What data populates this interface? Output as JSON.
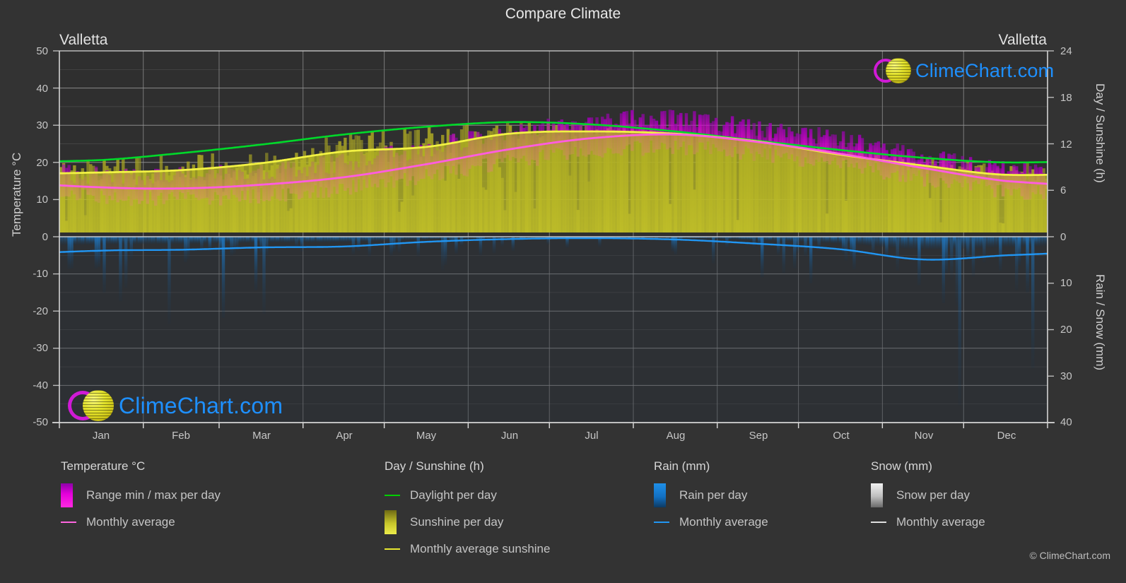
{
  "title": "Compare Climate",
  "city_left": "Valletta",
  "city_right": "Valletta",
  "axes": {
    "left_title": "Temperature °C",
    "right_title_top": "Day / Sunshine (h)",
    "right_title_bottom": "Rain / Snow (mm)",
    "left_ticks": [
      "50",
      "40",
      "30",
      "20",
      "10",
      "0",
      "-10",
      "-20",
      "-30",
      "-40",
      "-50"
    ],
    "right_ticks_top": [
      "24",
      "18",
      "12",
      "6",
      "0"
    ],
    "right_ticks_bottom": [
      "10",
      "20",
      "30",
      "40"
    ],
    "x_ticks": [
      "Jan",
      "Feb",
      "Mar",
      "Apr",
      "May",
      "Jun",
      "Jul",
      "Aug",
      "Sep",
      "Oct",
      "Nov",
      "Dec"
    ]
  },
  "legend": {
    "groups": [
      {
        "title": "Temperature °C",
        "items": [
          {
            "label": "Range min / max per day",
            "swatch": "gradient-magenta",
            "color": "#f000e0"
          },
          {
            "label": "Monthly average",
            "swatch": "line",
            "color": "#ff66e0"
          }
        ]
      },
      {
        "title": "Day / Sunshine (h)",
        "items": [
          {
            "label": "Daylight per day",
            "swatch": "line",
            "color": "#00d000"
          },
          {
            "label": "Sunshine per day",
            "swatch": "gradient-yellow",
            "color": "#e8e830"
          },
          {
            "label": "Monthly average sunshine",
            "swatch": "line",
            "color": "#e8e830"
          }
        ]
      },
      {
        "title": "Rain (mm)",
        "items": [
          {
            "label": "Rain per day",
            "swatch": "gradient-blue",
            "color": "#1a8fe0"
          },
          {
            "label": "Monthly average",
            "swatch": "line",
            "color": "#2196f3"
          }
        ]
      },
      {
        "title": "Snow (mm)",
        "items": [
          {
            "label": "Snow per day",
            "swatch": "gradient-white",
            "color": "#e0e0e0"
          },
          {
            "label": "Monthly average",
            "swatch": "line",
            "color": "#e0e0e0"
          }
        ]
      }
    ],
    "copyright": "© ClimeChart.com"
  },
  "logo": {
    "text": "ClimeChart.com"
  },
  "chart_data": {
    "type": "area",
    "title": "Compare Climate",
    "subtitle": "Valletta",
    "xlabel": "",
    "ylabel": "Temperature °C",
    "ylim": [
      -50,
      50
    ],
    "y2lim_top": [
      0,
      24
    ],
    "y2lim_bottom": [
      0,
      40
    ],
    "grid": true,
    "legend_position": "bottom",
    "categories": [
      "Jan",
      "Feb",
      "Mar",
      "Apr",
      "May",
      "Jun",
      "Jul",
      "Aug",
      "Sep",
      "Oct",
      "Nov",
      "Dec"
    ],
    "series": [
      {
        "name": "Monthly average temperature",
        "unit": "°C",
        "color": "#ff66e0",
        "axis": "left",
        "values": [
          13.3,
          13.0,
          14.0,
          16.0,
          19.5,
          23.5,
          26.5,
          27.5,
          25.5,
          22.3,
          18.5,
          15.0
        ]
      },
      {
        "name": "Daily max temperature",
        "unit": "°C",
        "color": "#d000d0",
        "axis": "left",
        "values": [
          16.2,
          16.0,
          17.3,
          19.6,
          23.5,
          27.8,
          30.8,
          31.3,
          29.0,
          25.7,
          21.6,
          17.9
        ]
      },
      {
        "name": "Daily min temperature",
        "unit": "°C",
        "color": "#d000d0",
        "axis": "left",
        "values": [
          10.5,
          10.2,
          11.1,
          13.0,
          16.2,
          20.1,
          22.9,
          23.9,
          22.2,
          19.3,
          15.6,
          12.3
        ]
      },
      {
        "name": "Daylight per day",
        "unit": "h",
        "color": "#00d000",
        "axis": "right_top",
        "values": [
          9.9,
          10.8,
          11.9,
          13.2,
          14.2,
          14.8,
          14.5,
          13.6,
          12.4,
          11.2,
          10.2,
          9.6
        ]
      },
      {
        "name": "Monthly average sunshine",
        "unit": "h",
        "color": "#e8e830",
        "axis": "right_top",
        "values": [
          8.3,
          8.6,
          9.5,
          11.0,
          11.6,
          13.3,
          13.6,
          13.3,
          12.3,
          10.6,
          9.2,
          8.0
        ]
      },
      {
        "name": "Rain monthly average",
        "unit": "mm",
        "color": "#2196f3",
        "axis": "right_bottom",
        "values": [
          3.0,
          2.8,
          2.3,
          2.1,
          1.1,
          0.5,
          0.3,
          0.6,
          1.5,
          2.7,
          4.9,
          4.0
        ]
      }
    ],
    "annotations": [
      {
        "text": "ClimeChart.com",
        "position": "top-right"
      },
      {
        "text": "ClimeChart.com",
        "position": "bottom-left"
      }
    ]
  }
}
